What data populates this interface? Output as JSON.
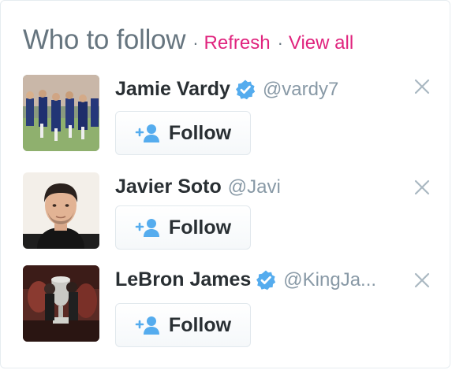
{
  "widget": {
    "title": "Who to follow",
    "separator": "·",
    "refresh_label": "Refresh",
    "view_all_label": "View all"
  },
  "users": [
    {
      "name": "Jamie Vardy",
      "handle": "@vardy7",
      "verified": true,
      "follow_label": "Follow",
      "avatar": "team-training-photo"
    },
    {
      "name": "Javier Soto",
      "handle": "@Javi",
      "verified": false,
      "follow_label": "Follow",
      "avatar": "portrait-photo"
    },
    {
      "name": "LeBron James",
      "handle": "@KingJa...",
      "verified": true,
      "follow_label": "Follow",
      "avatar": "trophy-photo"
    }
  ],
  "colors": {
    "accent": "#e0247e",
    "verified": "#55acee",
    "muted": "#66757f",
    "handle": "#8899a6",
    "text": "#292f33"
  },
  "icons": {
    "follow": "add-user-icon",
    "verified": "verified-badge-icon",
    "dismiss": "close-icon"
  }
}
